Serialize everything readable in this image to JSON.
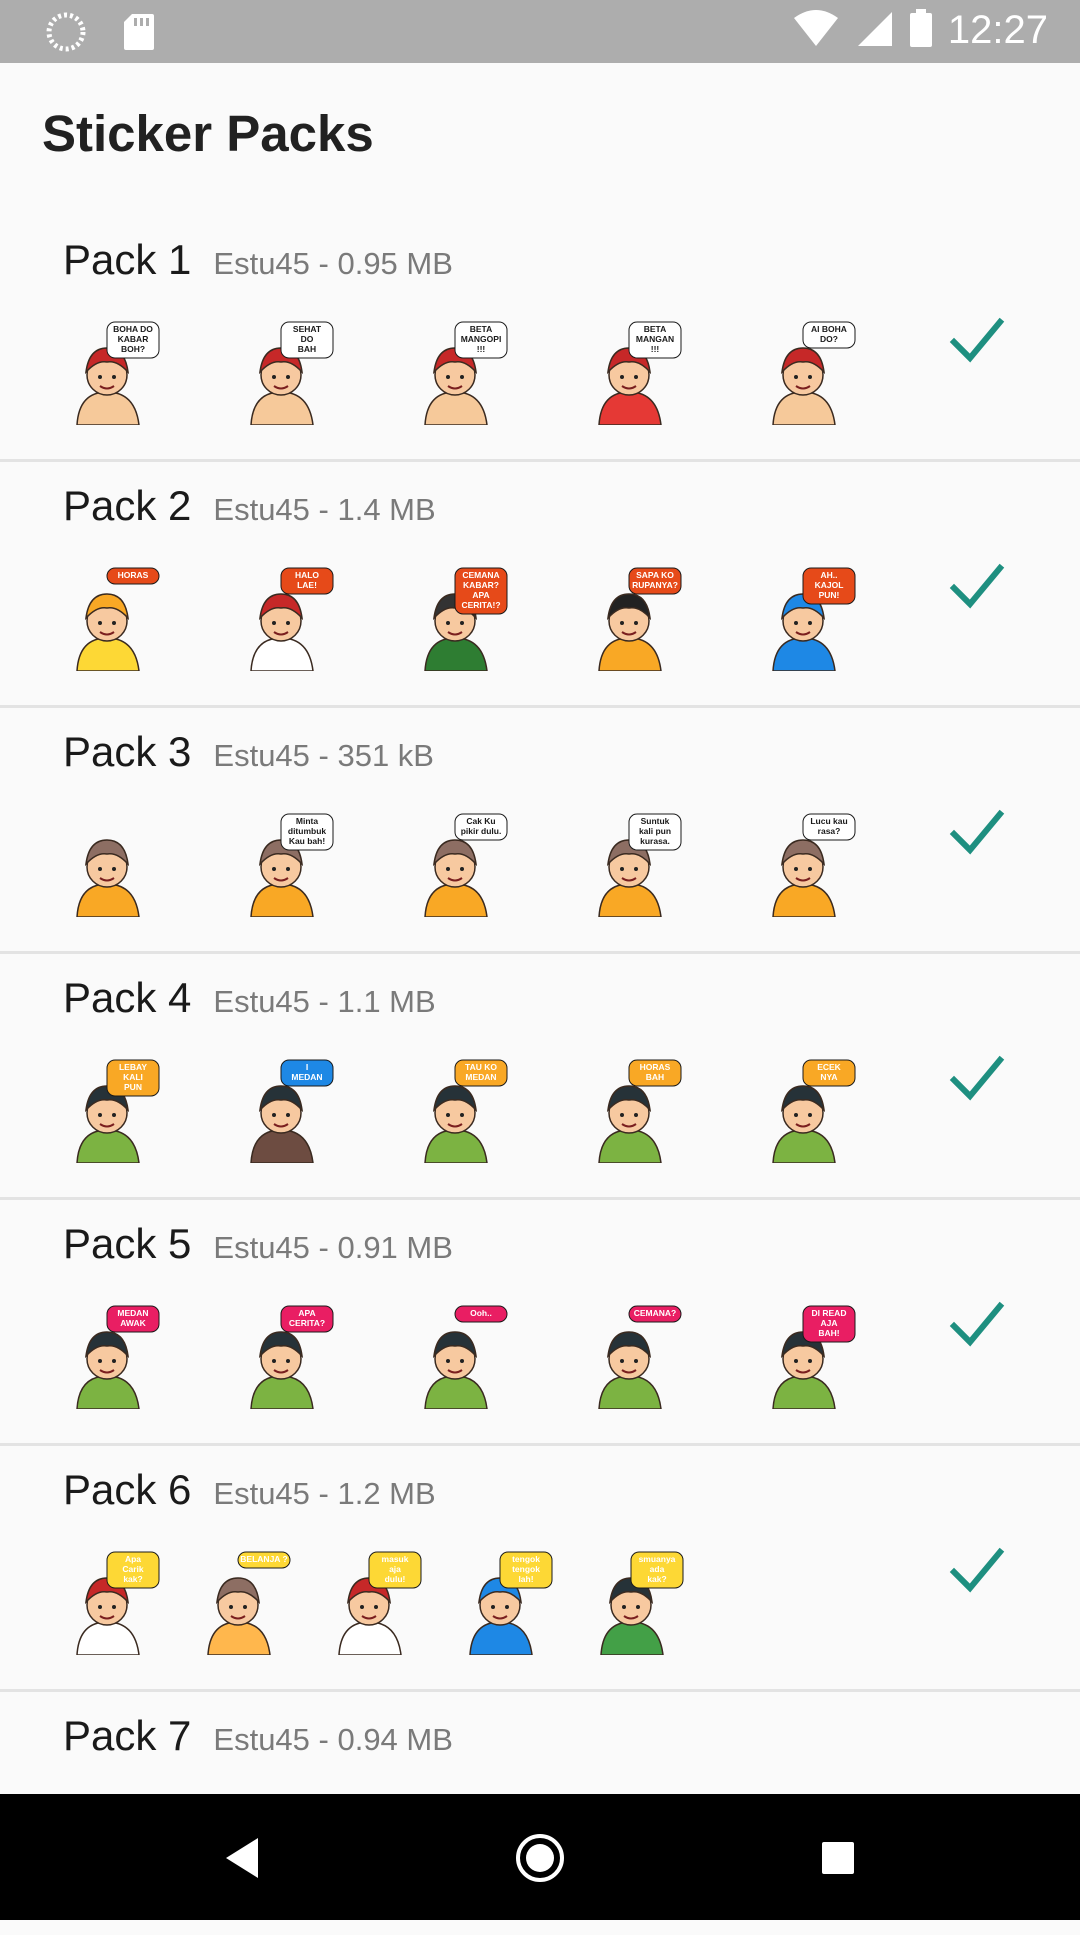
{
  "status_bar": {
    "time": "12:27"
  },
  "app": {
    "title": "Sticker Packs"
  },
  "packs": [
    {
      "name": "Pack 1",
      "meta": "Estu45 - 0.95 MB",
      "added": true,
      "stickers": [
        {
          "text": [
            "BOHA DO",
            "KABAR",
            "BOH?"
          ],
          "color": "#ffffff",
          "hat": "#c62828",
          "shirt": "#f6c99a"
        },
        {
          "text": [
            "SEHAT",
            "DO",
            "BAH"
          ],
          "color": "#ffffff",
          "hat": "#c62828",
          "shirt": "#f6c99a"
        },
        {
          "text": [
            "BETA",
            "MANGOPI",
            "!!!"
          ],
          "color": "#ffffff",
          "hat": "#c62828",
          "shirt": "#f6c99a"
        },
        {
          "text": [
            "BETA",
            "MANGAN",
            "!!!"
          ],
          "color": "#ffffff",
          "hat": "#c62828",
          "shirt": "#e53935"
        },
        {
          "text": [
            "AI BOHA",
            "DO?"
          ],
          "color": "#ffffff",
          "hat": "#c62828",
          "shirt": "#f6c99a"
        }
      ]
    },
    {
      "name": "Pack 2",
      "meta": "Estu45 - 1.4 MB",
      "added": true,
      "stickers": [
        {
          "text": [
            "HORAS"
          ],
          "color": "#e64a19",
          "hat": "#f9a825",
          "shirt": "#fdd835"
        },
        {
          "text": [
            "HALO",
            "LAE!"
          ],
          "color": "#e64a19",
          "hat": "#c62828",
          "shirt": "#ffffff"
        },
        {
          "text": [
            "CEMANA",
            "KABAR?",
            "APA",
            "CERITA!?"
          ],
          "color": "#e64a19",
          "hat": "#333333",
          "shirt": "#2e7d32"
        },
        {
          "text": [
            "SAPA KO",
            "RUPANYA?"
          ],
          "color": "#e64a19",
          "hat": "#222222",
          "shirt": "#f9a825"
        },
        {
          "text": [
            "AH..",
            "KAJOL",
            "PUN!"
          ],
          "color": "#e64a19",
          "hat": "#1e88e5",
          "shirt": "#1e88e5"
        }
      ]
    },
    {
      "name": "Pack 3",
      "meta": "Estu45 - 351 kB",
      "added": true,
      "stickers": [
        {
          "text": [],
          "color": "#ffffff",
          "hat": "#8d6e63",
          "shirt": "#f9a825"
        },
        {
          "text": [
            "Minta",
            "ditumbuk",
            "Kau bah!"
          ],
          "color": "#ffffff",
          "hat": "#8d6e63",
          "shirt": "#f9a825"
        },
        {
          "text": [
            "Cak Ku",
            "pikir dulu."
          ],
          "color": "#ffffff",
          "hat": "#8d6e63",
          "shirt": "#f9a825"
        },
        {
          "text": [
            "Suntuk",
            "kali pun",
            "kurasa."
          ],
          "color": "#ffffff",
          "hat": "#8d6e63",
          "shirt": "#f9a825"
        },
        {
          "text": [
            "Lucu kau",
            "rasa?"
          ],
          "color": "#ffffff",
          "hat": "#8d6e63",
          "shirt": "#f9a825"
        }
      ]
    },
    {
      "name": "Pack 4",
      "meta": "Estu45 - 1.1 MB",
      "added": true,
      "stickers": [
        {
          "text": [
            "LEBAY",
            "KALI",
            "PUN"
          ],
          "color": "#f9a825",
          "hat": "#263238",
          "shirt": "#7cb342"
        },
        {
          "text": [
            "I",
            "MEDAN"
          ],
          "color": "#1e88e5",
          "hat": "#263238",
          "shirt": "#6d4c41"
        },
        {
          "text": [
            "TAU KO",
            "MEDAN"
          ],
          "color": "#f9a825",
          "hat": "#263238",
          "shirt": "#7cb342"
        },
        {
          "text": [
            "HORAS",
            "BAH"
          ],
          "color": "#f9a825",
          "hat": "#263238",
          "shirt": "#7cb342"
        },
        {
          "text": [
            "ECEK",
            "NYA"
          ],
          "color": "#f9a825",
          "hat": "#263238",
          "shirt": "#7cb342"
        }
      ]
    },
    {
      "name": "Pack 5",
      "meta": "Estu45 - 0.91 MB",
      "added": true,
      "stickers": [
        {
          "text": [
            "MEDAN",
            "AWAK"
          ],
          "color": "#e91e63",
          "hat": "#263238",
          "shirt": "#7cb342"
        },
        {
          "text": [
            "APA",
            "CERITA?"
          ],
          "color": "#e91e63",
          "hat": "#263238",
          "shirt": "#7cb342"
        },
        {
          "text": [
            "Ooh.."
          ],
          "color": "#e91e63",
          "hat": "#263238",
          "shirt": "#7cb342"
        },
        {
          "text": [
            "CEMANA?"
          ],
          "color": "#e91e63",
          "hat": "#263238",
          "shirt": "#7cb342"
        },
        {
          "text": [
            "DI READ",
            "AJA",
            "BAH!"
          ],
          "color": "#e91e63",
          "hat": "#263238",
          "shirt": "#7cb342"
        }
      ]
    },
    {
      "name": "Pack 6",
      "meta": "Estu45 - 1.2 MB",
      "added": true,
      "stickers": [
        {
          "text": [
            "Apa",
            "Carik",
            "kak?"
          ],
          "color": "#fdd835",
          "hat": "#c62828",
          "shirt": "#ffffff"
        },
        {
          "text": [
            "BELANJA ?"
          ],
          "color": "#fdd835",
          "hat": "#8d6e63",
          "shirt": "#ffb74d"
        },
        {
          "text": [
            "masuk",
            "aja",
            "dulu!"
          ],
          "color": "#fdd835",
          "hat": "#c62828",
          "shirt": "#ffffff"
        },
        {
          "text": [
            "tengok",
            "tengok",
            "lah!"
          ],
          "color": "#fdd835",
          "hat": "#1e88e5",
          "shirt": "#1e88e5"
        },
        {
          "text": [
            "smuanya",
            "ada",
            "kak?"
          ],
          "color": "#fdd835",
          "hat": "#263238",
          "shirt": "#43a047"
        }
      ]
    },
    {
      "name": "Pack 7",
      "meta": "Estu45 - 0.94 MB",
      "added": false,
      "stickers": []
    }
  ],
  "colors": {
    "check": "#1e8f80",
    "status_bar": "#adadad"
  },
  "icons": {
    "status_left": [
      "sync-icon",
      "sd-card-icon"
    ],
    "status_right": [
      "wifi-icon",
      "signal-icon",
      "battery-icon"
    ],
    "nav": [
      "back-icon",
      "home-icon",
      "recents-icon"
    ]
  }
}
